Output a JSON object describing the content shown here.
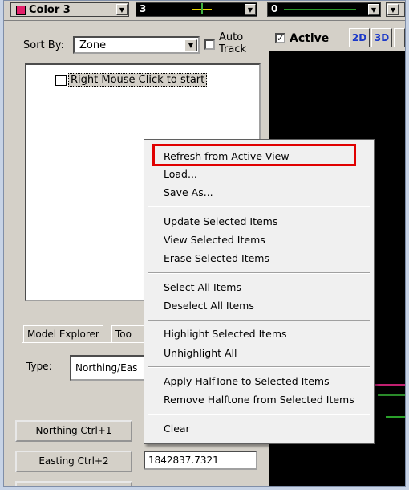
{
  "toolbar": {
    "color_label": "Color 3",
    "combo2_value": "3",
    "combo3_value": "0",
    "colors": {
      "swatch": "#e3206a"
    }
  },
  "sort_by": {
    "label": "Sort By:",
    "value": "Zone",
    "auto_track_label": "Auto\nTrack"
  },
  "tree": {
    "root_item": "Right Mouse Click to start"
  },
  "tabs": [
    {
      "label": "Model Explorer"
    },
    {
      "label": "Too"
    }
  ],
  "type": {
    "label": "Type:",
    "value": "Northing/Eas"
  },
  "buttons": {
    "northing": "Northing  Ctrl+1",
    "easting": "Easting  Ctrl+2"
  },
  "fields": {
    "easting_value": "1842837.7321"
  },
  "view": {
    "active_label": "Active",
    "active_checked": true,
    "tab_2d": "2D",
    "tab_3d": "3D"
  },
  "context_menu": {
    "groups": [
      [
        "Refresh from Active View",
        "Load...",
        "Save As..."
      ],
      [
        "Update Selected Items",
        "View Selected Items",
        "Erase Selected Items"
      ],
      [
        "Select All Items",
        "Deselect All Items"
      ],
      [
        "Highlight Selected Items",
        "Unhighlight All"
      ],
      [
        "Apply HalfTone to Selected Items",
        "Remove Halftone from Selected Items"
      ],
      [
        "Clear"
      ]
    ],
    "highlighted_item": "Refresh from Active View",
    "highlight_color": "#e00000"
  }
}
